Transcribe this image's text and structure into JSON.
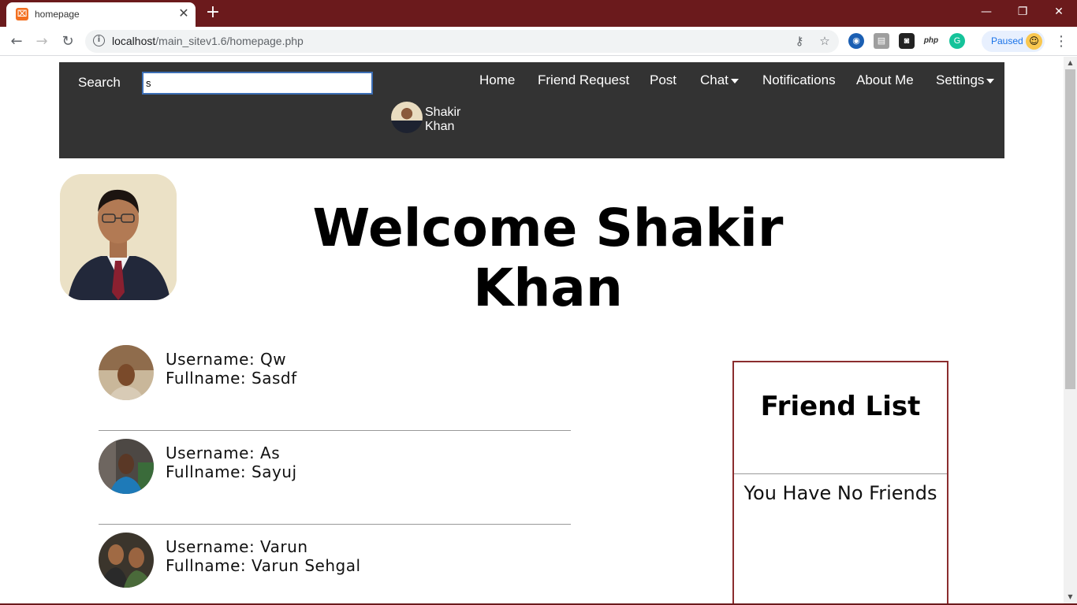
{
  "browser": {
    "tab_title": "homepage",
    "url_host": "localhost",
    "url_path": "/main_sitev1.6/homepage.php",
    "profile_status": "Paused"
  },
  "nav": {
    "search_label": "Search",
    "search_value": "s",
    "links": {
      "home": "Home",
      "friend_request": "Friend Request",
      "post": "Post",
      "chat": "Chat",
      "notifications": "Notifications",
      "about": "About Me",
      "settings": "Settings"
    },
    "user_name": "Shakir Khan"
  },
  "welcome": {
    "title": "Welcome Shakir Khan"
  },
  "users": [
    {
      "username": "Username: Qw",
      "fullname": "Fullname: Sasdf"
    },
    {
      "username": "Username: As",
      "fullname": "Fullname: Sayuj"
    },
    {
      "username": "Username: Varun",
      "fullname": "Fullname: Varun Sehgal"
    }
  ],
  "friend_list": {
    "title": "Friend List",
    "empty_message": "You Have No Friends"
  },
  "colors": {
    "titlebar": "#6b1a1c",
    "navbar": "#333333",
    "friend_border": "#8b2d2e"
  }
}
